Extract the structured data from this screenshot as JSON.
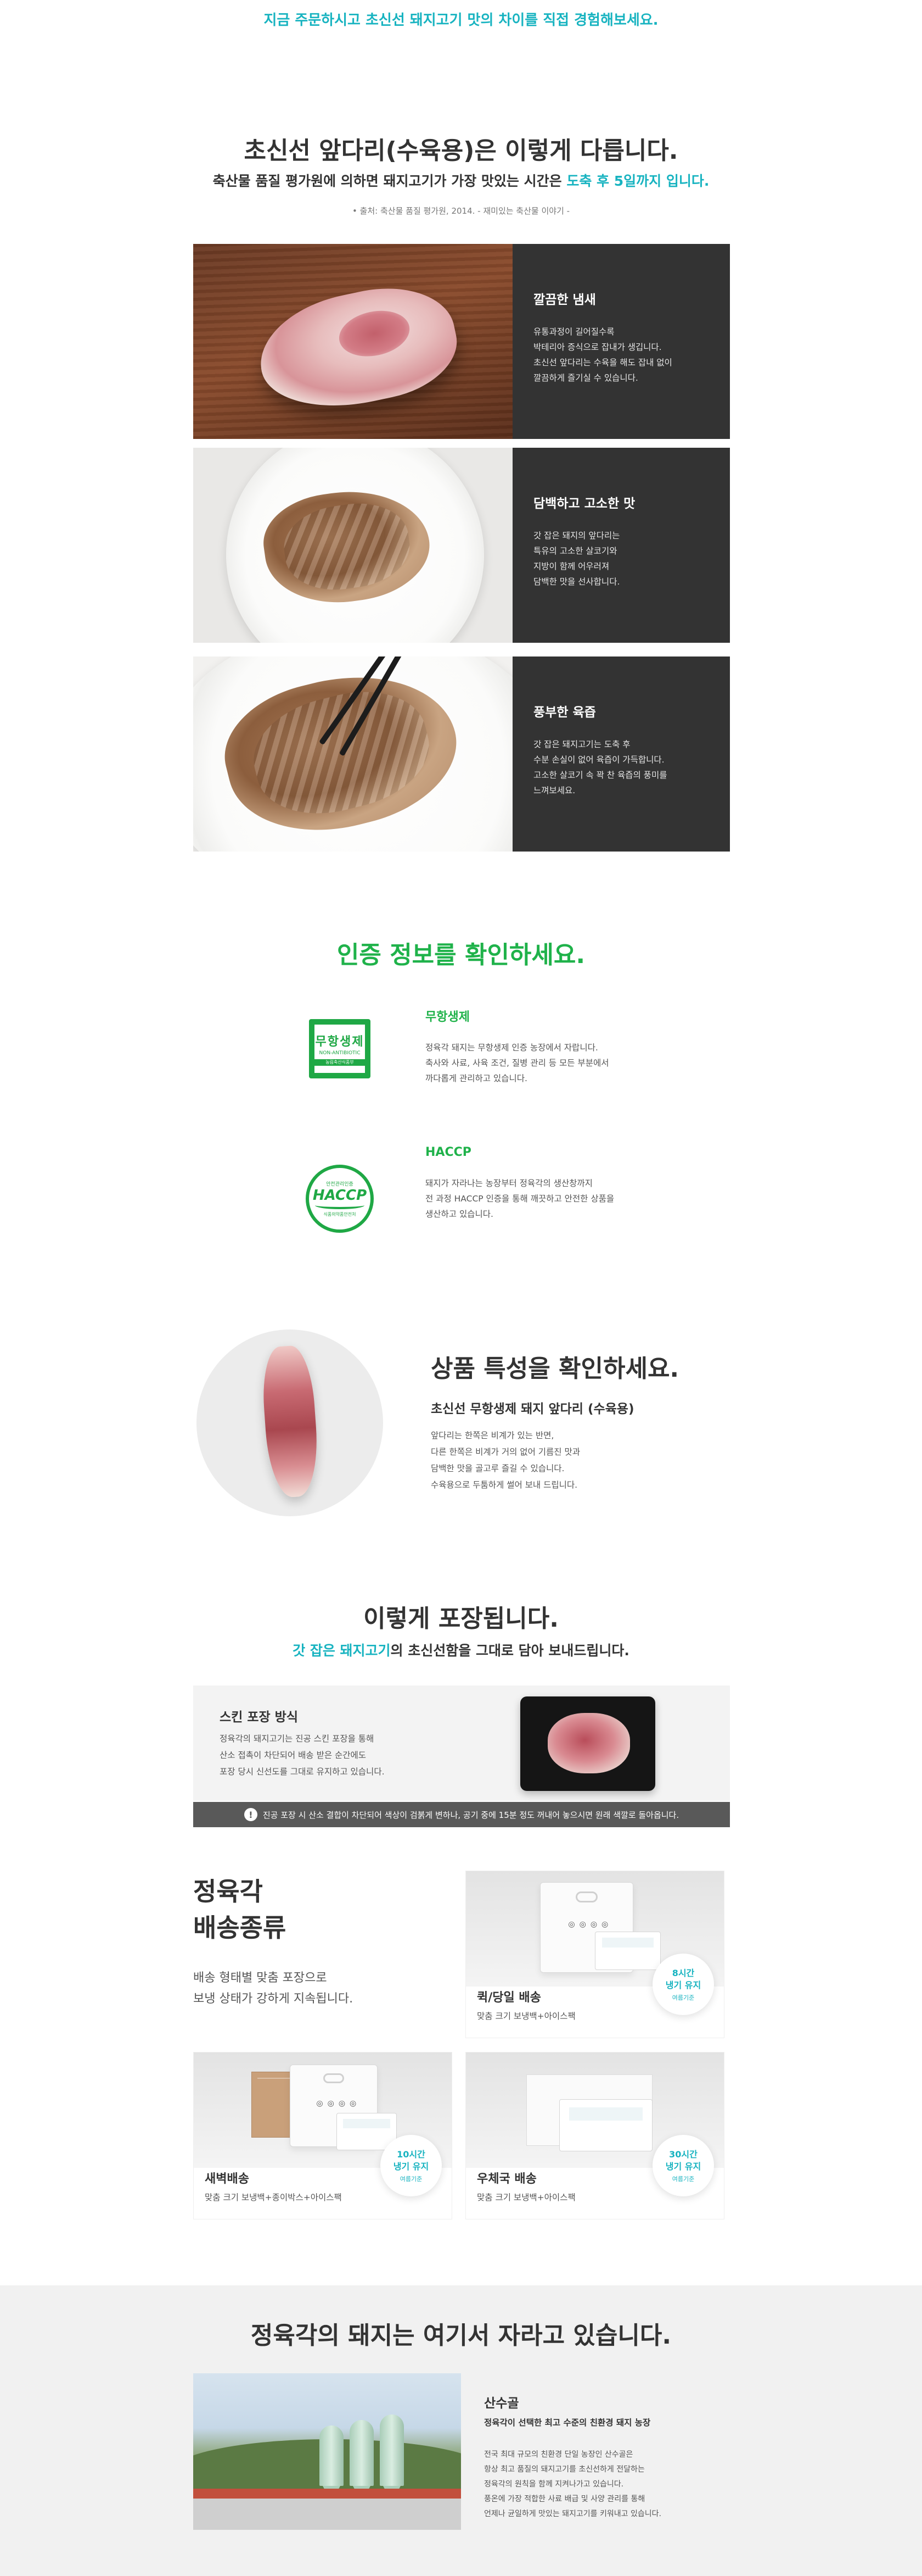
{
  "top_banner": "지금 주문하시고 초신선 돼지고기 맛의 차이를 직접 경험해보세요.",
  "intro": {
    "title": "초신선 앞다리(수육용)은 이렇게 다릅니다.",
    "subtitle_prefix": "축산물 품질 평가원에 의하면 돼지고기가 가장 맛있는 시간은 ",
    "subtitle_highlight": "도축 후 5일까지 입니다.",
    "source": "• 출처: 축산물 품질 평가원, 2014. - 재미있는 축산물 이야기 -"
  },
  "features": [
    {
      "title": "깔끔한 냄새",
      "desc": "유통과정이 길어질수록\n박테리아 증식으로 잡내가 생깁니다.\n초신선 앞다리는 수육을 해도 잡내 없이\n깔끔하게 즐기실 수 있습니다."
    },
    {
      "title": "담백하고 고소한 맛",
      "desc": "갓 잡은 돼지의 앞다리는\n특유의 고소한 살코기와\n지방이 함께 어우러져\n담백한 맛을 선사합니다."
    },
    {
      "title": "풍부한 육즙",
      "desc": "갓 잡은 돼지고기는 도축 후\n수분 손실이 없어 육즙이 가득합니다.\n고소한 살코기 속 꽉 찬 육즙의 풍미를\n느껴보세요."
    }
  ],
  "certification": {
    "heading": "인증 정보를 확인하세요.",
    "items": [
      {
        "title": "무항생제",
        "desc": "정육각 돼지는 무항생제 인증 농장에서 자랍니다.\n축사와 사료, 사육 조건, 질병 관리 등 모든 부분에서\n까다롭게 관리하고 있습니다.",
        "icon": "antibiotic-free-certification-icon",
        "icon_big": "무항생제",
        "icon_small": "NON-ANTIBIOTIC",
        "icon_bar": "농림축산식품부"
      },
      {
        "title": "HACCP",
        "desc": "돼지가 자라나는 농장부터 정육각의 생산창까지\n전 과정 HACCP 인증을 통해 깨끗하고 안전한 상품을\n생산하고 있습니다.",
        "icon": "haccp-certification-icon",
        "icon_top": "안전관리인증",
        "icon_big": "HACCP",
        "icon_small": "식품의약품안전처"
      }
    ]
  },
  "product": {
    "heading": "상품 특성을 확인하세요.",
    "name": "초신선 무항생제 돼지 앞다리 (수육용)",
    "desc": "앞다리는 한쪽은 비계가 있는 반면,\n다른 한쪽은 비계가 거의 없어 기름진 맛과\n담백한 맛을 골고루 즐길 수 있습니다.\n수육용으로 두툼하게 썰어 보내 드립니다."
  },
  "packaging": {
    "heading": "이렇게 포장됩니다.",
    "sub_highlight": "갓 잡은 돼지고기",
    "sub_rest": "의 초신선함을 그대로 담아 보내드립니다.",
    "skin": {
      "title": "스킨 포장 방식",
      "desc": "정육각의 돼지고기는 진공 스킨 포장을 통해\n산소 접촉이 차단되어 배송 받은 순간에도\n포장 당시 신선도를 그대로 유지하고 있습니다."
    },
    "note_icon": "!",
    "note": "진공 포장 시 산소 결합이 차단되어 색상이 검붉게 변하나, 공기 중에 15분 정도 꺼내어 놓으시면 원래 색깔로 돌아옵니다."
  },
  "shipping": {
    "heading": "정육각\n배송종류",
    "desc": "배송 형태별 맞춤 포장으로\n보냉 상태가 강하게 지속됩니다.",
    "cards": [
      {
        "name": "퀵/당일 배송",
        "spec": "맞춤 크기 보냉백+아이스팩",
        "badge_line1": "8시간",
        "badge_line2": "냉기 유지",
        "badge_note": "여름기준"
      },
      {
        "name": "새벽배송",
        "spec": "맞춤 크기 보냉백+종이박스+아이스팩",
        "badge_line1": "10시간",
        "badge_line2": "냉기 유지",
        "badge_note": "여름기준"
      },
      {
        "name": "우체국 배송",
        "spec": "맞춤 크기 보냉백+아이스팩",
        "badge_line1": "30시간",
        "badge_line2": "냉기 유지",
        "badge_note": "여름기준"
      }
    ],
    "bag_dots": "◎◎◎◎"
  },
  "farm": {
    "heading": "정육각의 돼지는 여기서 자라고 있습니다.",
    "name": "산수골",
    "subtitle": "정육각이 선택한 최고 수준의 친환경 돼지 농장",
    "desc": "전국 최대 규모의 친환경 단일 농장인 산수골은\n항상 최고 품질의 돼지고기를 초신선하게 전달하는\n정육각의 원칙을 함께 지켜나가고 있습니다.\n풍온에 가장 적합한 사료 배급 및 사양 관리를 통해\n언제나 균일하게 맛있는 돼지고기를 키워내고 있습니다."
  },
  "colors": {
    "teal": "#17b3c0",
    "green": "#1fb24a",
    "dark_panel": "#333333",
    "note_bar": "#595959"
  }
}
